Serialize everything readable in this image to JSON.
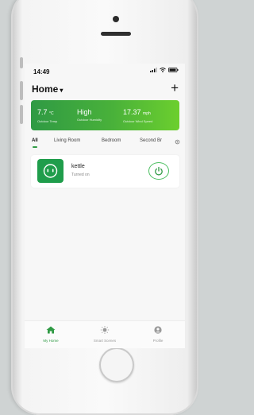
{
  "status_bar": {
    "time": "14:49"
  },
  "header": {
    "title": "Home",
    "add_symbol": "+"
  },
  "weather": [
    {
      "value": "7.7",
      "unit": "°C",
      "label": "Outdoor Temp"
    },
    {
      "value": "High",
      "unit": "",
      "label": "Outdoor Humidity"
    },
    {
      "value": "17.37",
      "unit": "mph",
      "label": "Outdoor Wind Speed"
    }
  ],
  "tabs": [
    "All",
    "Living Room",
    "Bedroom",
    "Second Br"
  ],
  "device": {
    "name": "kettle",
    "status": "Turned on",
    "icon": "socket-icon"
  },
  "bottom_nav": [
    {
      "label": "My Home",
      "icon": "home-icon"
    },
    {
      "label": "Smart Scenes",
      "icon": "sun-icon"
    },
    {
      "label": "Profile",
      "icon": "profile-icon"
    }
  ],
  "colors": {
    "accent": "#2f9a44",
    "card_gradient_end": "#6ccf2e"
  }
}
